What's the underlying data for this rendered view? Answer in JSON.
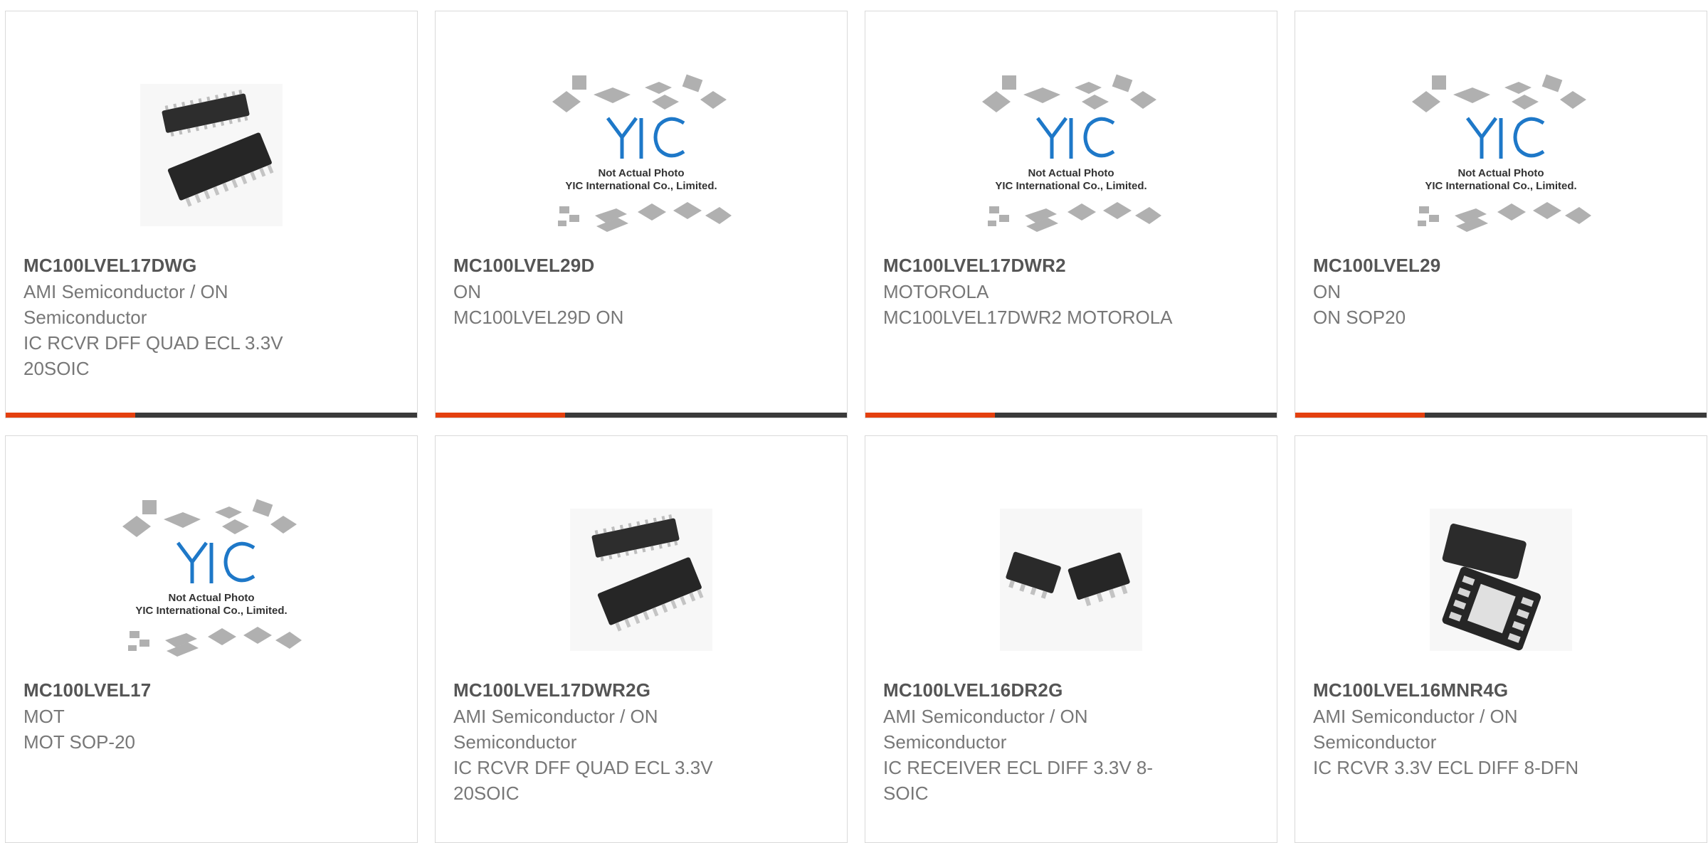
{
  "products": [
    {
      "part_number": "MC100LVEL17DWG",
      "manufacturer": "AMI Semiconductor / ON Semiconductor",
      "description": "IC RCVR DFF QUAD ECL 3.3V 20SOIC",
      "image": "soic-20-chip-photo"
    },
    {
      "part_number": "MC100LVEL29D",
      "manufacturer": "ON",
      "description": "MC100LVEL29D ON",
      "image": "yic-placeholder",
      "placeholder_line1": "Not Actual Photo",
      "placeholder_line2": "YIC International Co., Limited."
    },
    {
      "part_number": "MC100LVEL17DWR2",
      "manufacturer": "MOTOROLA",
      "description": "MC100LVEL17DWR2 MOTOROLA",
      "image": "yic-placeholder",
      "placeholder_line1": "Not Actual Photo",
      "placeholder_line2": "YIC International Co., Limited."
    },
    {
      "part_number": "MC100LVEL29",
      "manufacturer": "ON",
      "description": "ON SOP20",
      "image": "yic-placeholder",
      "placeholder_line1": "Not Actual Photo",
      "placeholder_line2": "YIC International Co., Limited."
    },
    {
      "part_number": "MC100LVEL17",
      "manufacturer": "MOT",
      "description": "MOT SOP-20",
      "image": "yic-placeholder",
      "placeholder_line1": "Not Actual Photo",
      "placeholder_line2": "YIC International Co., Limited."
    },
    {
      "part_number": "MC100LVEL17DWR2G",
      "manufacturer": "AMI Semiconductor / ON Semiconductor",
      "description": "IC RCVR DFF QUAD ECL 3.3V 20SOIC",
      "image": "soic-20-chip-photo"
    },
    {
      "part_number": "MC100LVEL16DR2G",
      "manufacturer": "AMI Semiconductor / ON Semiconductor",
      "description": "IC RECEIVER ECL DIFF 3.3V 8-SOIC",
      "image": "soic-8-chip-photo"
    },
    {
      "part_number": "MC100LVEL16MNR4G",
      "manufacturer": "AMI Semiconductor / ON Semiconductor",
      "description": "IC RCVR 3.3V ECL DIFF 8-DFN",
      "image": "dfn-8-chip-photo"
    }
  ],
  "colors": {
    "accent": "#e4400f",
    "bar": "#3a3a3a",
    "logo_blue": "#1e78c8"
  }
}
